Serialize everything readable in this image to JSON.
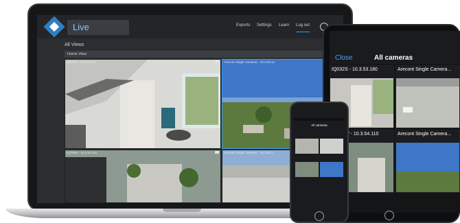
{
  "app": {
    "title": "Live"
  },
  "nav": {
    "items": [
      {
        "label": "Exports"
      },
      {
        "label": "Settings"
      },
      {
        "label": "Learn"
      },
      {
        "label": "Log out"
      }
    ]
  },
  "main": {
    "section_title": "All Views",
    "view_name": "Home View",
    "cameras": [
      {
        "label": "IQ032S - 10.3.53.180"
      },
      {
        "label": "Arecont Single Cameras - 10.3.53.14"
      },
      {
        "label": "IQ762W - 10.3.54.110"
      },
      {
        "label": "Arecont Single Cameras - 10.3.54.1"
      }
    ]
  },
  "tablet": {
    "close_label": "Close",
    "title": "All cameras",
    "cameras": [
      {
        "label": "IQ032S - 10.3.53.180"
      },
      {
        "label": "Arecont Single Camera..."
      },
      {
        "label": "IQ762W - 10.3.54.110"
      },
      {
        "label": "Arecont Single Camera..."
      }
    ]
  },
  "phone": {
    "title": "All cameras"
  },
  "colors": {
    "accent": "#2f7fc0",
    "selection": "#3aa0ff",
    "tablet_close": "#48a8ff"
  },
  "icons": [
    "logo-icon",
    "power-icon",
    "home-button-icon"
  ]
}
